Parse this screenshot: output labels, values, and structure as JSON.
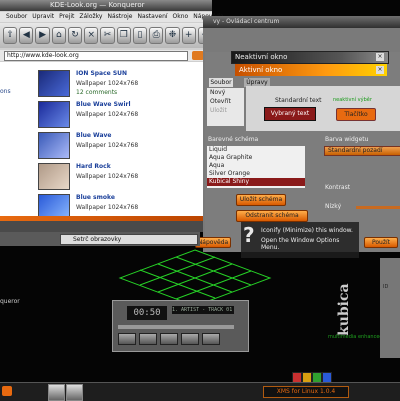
{
  "konqueror": {
    "title": "KDE-Look.org — Konqueror",
    "menu": [
      "Soubor",
      "Upravit",
      "Prejit",
      "Záložky",
      "Nástroje",
      "Nastavení",
      "Okno",
      "Nápověda"
    ],
    "location": "http://www.kde-look.org",
    "sidebar_text": "ons",
    "wallpapers": [
      {
        "name": "ION Space SUN",
        "size": "Wallpaper 1024x768",
        "comments": "12 comments",
        "color1": "#1a2a7a",
        "color2": "#4a6ad8"
      },
      {
        "name": "Blue Wave Swirl",
        "size": "Wallpaper 1024x768",
        "comments": "",
        "color1": "#1a2a9a",
        "color2": "#6a8ae8"
      },
      {
        "name": "Blue Wave",
        "size": "Wallpaper 1024x768",
        "comments": "",
        "color1": "#3a5ab8",
        "color2": "#aabaf8"
      },
      {
        "name": "Hard Rock",
        "size": "Wallpaper 1024x768",
        "comments": "",
        "color1": "#b09a88",
        "color2": "#e8d8c8"
      },
      {
        "name": "Blue smoke",
        "size": "Wallpaper 1024x768",
        "comments": "",
        "color1": "#2a5ad8",
        "color2": "#8ab8ff"
      }
    ]
  },
  "control_center": {
    "title": "vy - Ovládací centrum",
    "inactive_window": "Neaktivní okno",
    "active_window": "Aktivní okno",
    "tabs": [
      "Soubor",
      "Úpravy"
    ],
    "menu_preview": [
      "Nový",
      "Otevřít",
      "Uložit"
    ],
    "standard_text": "Standardní text",
    "selected_text": "Vybraný text",
    "inactive_selection": "neaktivní výběr",
    "button_sample": "Tlačítko",
    "scheme_label": "Barevné schéma",
    "schemes": [
      "Liquid",
      "Aqua Graphite",
      "Aqua",
      "Silver Orange",
      "Kubical Shiny"
    ],
    "selected_scheme": "Kubical Shiny",
    "save_scheme": "Uložit schéma",
    "remove_scheme": "Odstranit schéma",
    "widget_color_label": "Barva widgetu",
    "widget_color": "Standardní pozadí",
    "contrast_label": "Kontrast",
    "contrast_low": "Nízký",
    "help": "Nápověda",
    "apply": "Použít"
  },
  "wallpaper_bar": {
    "combo": "Setrč obrazovky"
  },
  "tooltip": {
    "line1": "Iconify (Minimize) this window.",
    "line2": "Open the Window Options Menu."
  },
  "desktop": {
    "label": "queror",
    "kubica": "kubica",
    "multimedia": "multimedia enhanced with",
    "right_panel": "ID"
  },
  "xmms": {
    "time": "00:50",
    "track": "1. ARTIST - TRACK 01 (2:25)"
  },
  "taskbar": {
    "xms": "XMS for Linux 1.0.4"
  },
  "colors": {
    "accent": "#e86a10",
    "selection": "#8a1a1a",
    "tray": [
      "#c83030",
      "#d8a010",
      "#30a030",
      "#2a5ad8"
    ]
  }
}
